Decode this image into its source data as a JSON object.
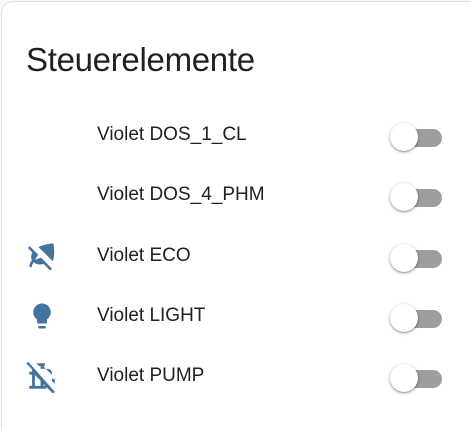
{
  "card": {
    "title": "Steuerelemente"
  },
  "colors": {
    "icon": "#44739e",
    "track_off": "#9e9e9e",
    "thumb": "#ffffff",
    "text": "#212121"
  },
  "entities": [
    {
      "label": "Violet DOS_1_CL",
      "icon": "none",
      "state": "off"
    },
    {
      "label": "Violet DOS_4_PHM",
      "icon": "none",
      "state": "off"
    },
    {
      "label": "Violet ECO",
      "icon": "leaf-off-icon",
      "state": "off"
    },
    {
      "label": "Violet LIGHT",
      "icon": "lightbulb-icon",
      "state": "off"
    },
    {
      "label": "Violet PUMP",
      "icon": "pump-off-icon",
      "state": "off"
    }
  ]
}
